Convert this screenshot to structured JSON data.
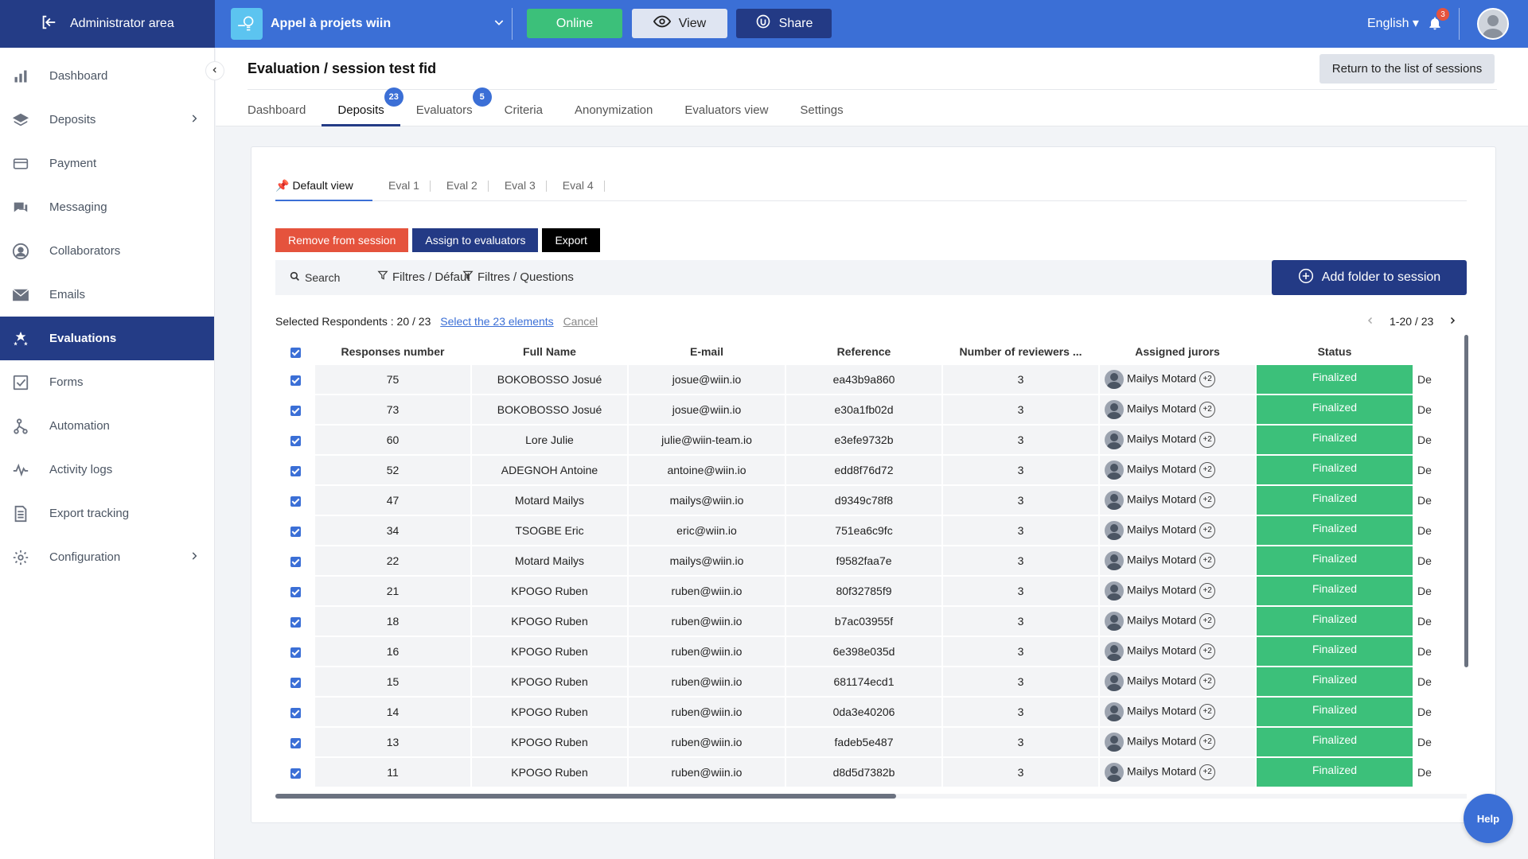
{
  "topbar": {
    "admin_area": "Administrator area",
    "project_name": "Appel à projets wiin",
    "online": "Online",
    "view": "View",
    "share": "Share",
    "language": "English",
    "notif_count": "3"
  },
  "sidebar": {
    "items": [
      {
        "label": "Dashboard",
        "icon": "bar-chart-icon"
      },
      {
        "label": "Deposits",
        "icon": "layers-icon"
      },
      {
        "label": "Payment",
        "icon": "card-icon"
      },
      {
        "label": "Messaging",
        "icon": "chat-icon"
      },
      {
        "label": "Collaborators",
        "icon": "user-circle-icon"
      },
      {
        "label": "Emails",
        "icon": "envelope-icon"
      },
      {
        "label": "Evaluations",
        "icon": "stars-icon"
      },
      {
        "label": "Forms",
        "icon": "checkbox-icon"
      },
      {
        "label": "Automation",
        "icon": "flow-icon"
      },
      {
        "label": "Activity logs",
        "icon": "pulse-icon"
      },
      {
        "label": "Export tracking",
        "icon": "document-icon"
      },
      {
        "label": "Configuration",
        "icon": "gear-icon"
      }
    ]
  },
  "header": {
    "title": "Evaluation / session test fid",
    "return_button": "Return to the list of sessions",
    "tabs": [
      {
        "label": "Dashboard"
      },
      {
        "label": "Deposits",
        "badge": "23"
      },
      {
        "label": "Evaluators",
        "badge": "5"
      },
      {
        "label": "Criteria"
      },
      {
        "label": "Anonymization"
      },
      {
        "label": "Evaluators view"
      },
      {
        "label": "Settings"
      }
    ]
  },
  "views": [
    "Default view",
    "Eval 1",
    "Eval 2",
    "Eval 3",
    "Eval 4"
  ],
  "actions": {
    "remove": "Remove from session",
    "assign": "Assign to evaluators",
    "export": "Export",
    "add_folder": "Add folder to session"
  },
  "filters": {
    "search": "Search",
    "filter_default": "Filtres / Défaut",
    "filter_questions": "Filtres / Questions"
  },
  "selection": {
    "text": "Selected Respondents : 20 / 23",
    "select_all": "Select the 23 elements",
    "cancel": "Cancel",
    "pager": "1-20 / 23"
  },
  "table": {
    "columns": [
      "Responses number",
      "Full Name",
      "E-mail",
      "Reference",
      "Number of reviewers ...",
      "Assigned jurors",
      "Status"
    ],
    "rows": [
      {
        "resp": "75",
        "name": "BOKOBOSSO Josué",
        "email": "josue@wiin.io",
        "ref": "ea43b9a860",
        "reviewers": "3",
        "juror": "Mailys Motard",
        "more": "+2",
        "status": "Finalized",
        "extra": "De"
      },
      {
        "resp": "73",
        "name": "BOKOBOSSO Josué",
        "email": "josue@wiin.io",
        "ref": "e30a1fb02d",
        "reviewers": "3",
        "juror": "Mailys Motard",
        "more": "+2",
        "status": "Finalized",
        "extra": "De"
      },
      {
        "resp": "60",
        "name": "Lore Julie",
        "email": "julie@wiin-team.io",
        "ref": "e3efe9732b",
        "reviewers": "3",
        "juror": "Mailys Motard",
        "more": "+2",
        "status": "Finalized",
        "extra": "De"
      },
      {
        "resp": "52",
        "name": "ADEGNOH Antoine",
        "email": "antoine@wiin.io",
        "ref": "edd8f76d72",
        "reviewers": "3",
        "juror": "Mailys Motard",
        "more": "+2",
        "status": "Finalized",
        "extra": "De"
      },
      {
        "resp": "47",
        "name": "Motard Mailys",
        "email": "mailys@wiin.io",
        "ref": "d9349c78f8",
        "reviewers": "3",
        "juror": "Mailys Motard",
        "more": "+2",
        "status": "Finalized",
        "extra": "De"
      },
      {
        "resp": "34",
        "name": "TSOGBE Eric",
        "email": "eric@wiin.io",
        "ref": "751ea6c9fc",
        "reviewers": "3",
        "juror": "Mailys Motard",
        "more": "+2",
        "status": "Finalized",
        "extra": "De"
      },
      {
        "resp": "22",
        "name": "Motard Mailys",
        "email": "mailys@wiin.io",
        "ref": "f9582faa7e",
        "reviewers": "3",
        "juror": "Mailys Motard",
        "more": "+2",
        "status": "Finalized",
        "extra": "De"
      },
      {
        "resp": "21",
        "name": "KPOGO Ruben",
        "email": "ruben@wiin.io",
        "ref": "80f32785f9",
        "reviewers": "3",
        "juror": "Mailys Motard",
        "more": "+2",
        "status": "Finalized",
        "extra": "De"
      },
      {
        "resp": "18",
        "name": "KPOGO Ruben",
        "email": "ruben@wiin.io",
        "ref": "b7ac03955f",
        "reviewers": "3",
        "juror": "Mailys Motard",
        "more": "+2",
        "status": "Finalized",
        "extra": "De"
      },
      {
        "resp": "16",
        "name": "KPOGO Ruben",
        "email": "ruben@wiin.io",
        "ref": "6e398e035d",
        "reviewers": "3",
        "juror": "Mailys Motard",
        "more": "+2",
        "status": "Finalized",
        "extra": "De"
      },
      {
        "resp": "15",
        "name": "KPOGO Ruben",
        "email": "ruben@wiin.io",
        "ref": "681174ecd1",
        "reviewers": "3",
        "juror": "Mailys Motard",
        "more": "+2",
        "status": "Finalized",
        "extra": "De"
      },
      {
        "resp": "14",
        "name": "KPOGO Ruben",
        "email": "ruben@wiin.io",
        "ref": "0da3e40206",
        "reviewers": "3",
        "juror": "Mailys Motard",
        "more": "+2",
        "status": "Finalized",
        "extra": "De"
      },
      {
        "resp": "13",
        "name": "KPOGO Ruben",
        "email": "ruben@wiin.io",
        "ref": "fadeb5e487",
        "reviewers": "3",
        "juror": "Mailys Motard",
        "more": "+2",
        "status": "Finalized",
        "extra": "De"
      },
      {
        "resp": "11",
        "name": "KPOGO Ruben",
        "email": "ruben@wiin.io",
        "ref": "d8d5d7382b",
        "reviewers": "3",
        "juror": "Mailys Motard",
        "more": "+2",
        "status": "Finalized",
        "extra": "De"
      }
    ]
  },
  "help": "Help",
  "colors": {
    "primary": "#3b6fd6",
    "navy": "#243c86",
    "success": "#3cc07a",
    "danger": "#e5533d"
  }
}
